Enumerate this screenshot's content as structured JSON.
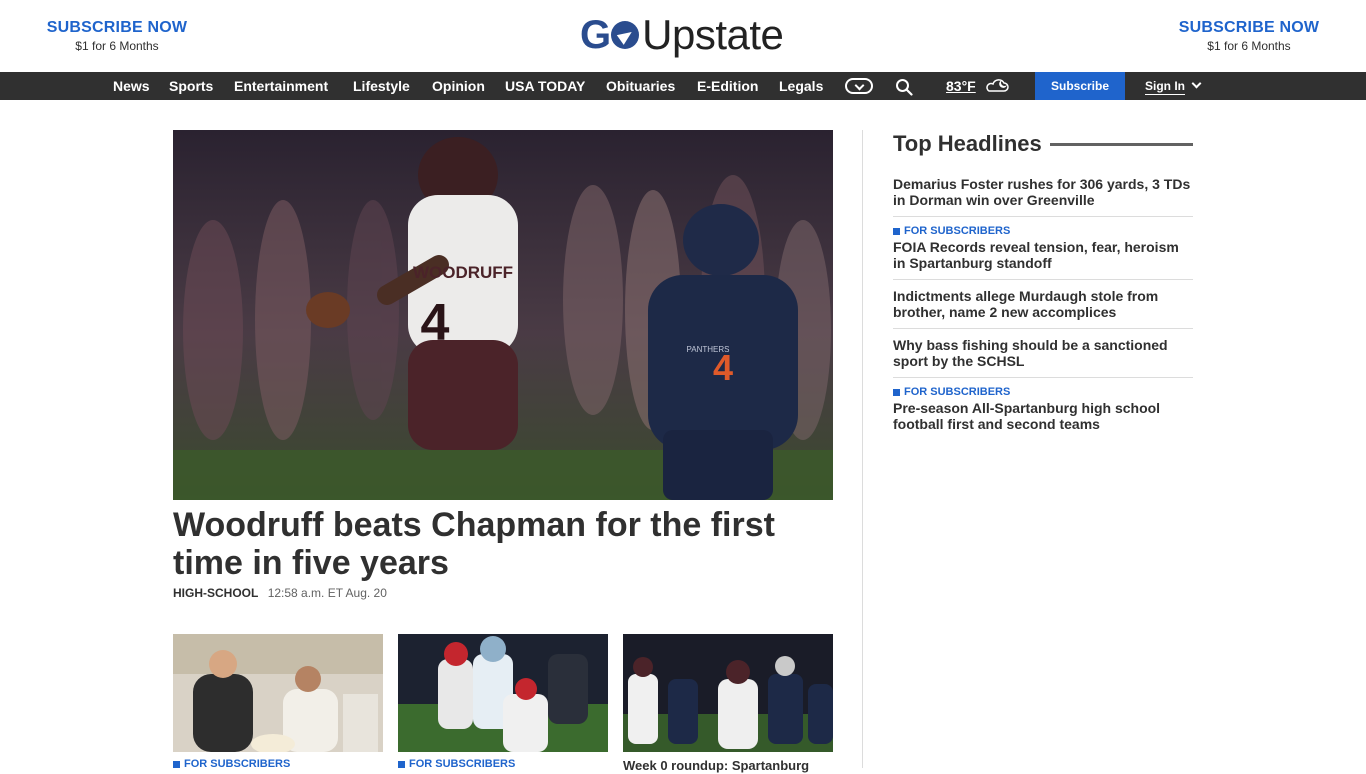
{
  "brand": {
    "logo_go": "G",
    "logo_go2": "",
    "logo_rest": "Upstate",
    "subscribe_left": {
      "title": "SUBSCRIBE NOW",
      "note": "$1 for 6 Months"
    },
    "subscribe_right": {
      "title": "SUBSCRIBE NOW",
      "note": "$1 for 6 Months"
    }
  },
  "nav": {
    "items": [
      "News",
      "Sports",
      "Entertainment",
      "Lifestyle",
      "Opinion",
      "USA TODAY",
      "Obituaries",
      "E-Edition",
      "Legals"
    ],
    "weather": "83°F",
    "subscribe": "Subscribe",
    "signin": "Sign In"
  },
  "hero": {
    "title": "Woodruff beats Chapman for the first time in five years",
    "section": "HIGH-SCHOOL",
    "timestamp": "12:58 a.m. ET Aug. 20",
    "jersey_text": "WOODRUFF",
    "jersey_number": "4",
    "opponent_number": "4",
    "opponent_text": "PANTHERS"
  },
  "cards": [
    {
      "kicker": "FOR SUBSCRIBERS",
      "title": ""
    },
    {
      "kicker": "FOR SUBSCRIBERS",
      "title": ""
    },
    {
      "kicker": "",
      "title": "Week 0 roundup: Spartanburg"
    }
  ],
  "top_headlines": {
    "heading": "Top Headlines",
    "items": [
      {
        "kicker": "",
        "title": "Demarius Foster rushes for 306 yards, 3 TDs in Dorman win over Greenville"
      },
      {
        "kicker": "FOR SUBSCRIBERS",
        "title": "FOIA Records reveal tension, fear, heroism in Spartanburg standoff"
      },
      {
        "kicker": "",
        "title": "Indictments allege Murdaugh stole from brother, name 2 new accomplices"
      },
      {
        "kicker": "",
        "title": "Why bass fishing should be a sanctioned sport by the SCHSL"
      },
      {
        "kicker": "FOR SUBSCRIBERS",
        "title": "Pre-season All-Spartanburg high school football first and second teams"
      }
    ]
  },
  "colors": {
    "accent": "#1f64cc",
    "nav_bg": "#303030",
    "text": "#303030",
    "logo_blue": "#2a4c8e"
  }
}
